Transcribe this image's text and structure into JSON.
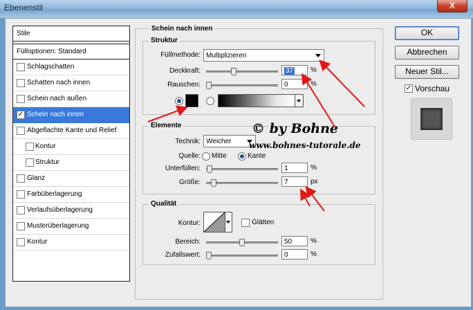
{
  "window": {
    "title": "Ebenenstil",
    "close_label": "X"
  },
  "style_list": {
    "header": "Stile",
    "blend_options": "Fülloptionen: Standard",
    "items": [
      {
        "label": "Schlagschatten",
        "checked": false
      },
      {
        "label": "Schatten nach innen",
        "checked": false
      },
      {
        "label": "Schein nach außen",
        "checked": false
      },
      {
        "label": "Schein nach innen",
        "checked": true
      },
      {
        "label": "Abgeflachte Kante und Relief",
        "checked": false
      },
      {
        "label": "Kontur",
        "checked": false
      },
      {
        "label": "Struktur",
        "checked": false
      },
      {
        "label": "Glanz",
        "checked": false
      },
      {
        "label": "Farbüberlagerung",
        "checked": false
      },
      {
        "label": "Verlaufsüberlagerung",
        "checked": false
      },
      {
        "label": "Musterüberlagerung",
        "checked": false
      },
      {
        "label": "Kontur",
        "checked": false
      }
    ],
    "check_mark": "✓"
  },
  "panel": {
    "title": "Schein nach innen",
    "struktur": {
      "title": "Struktur",
      "blend_mode_label": "Füllmethode:",
      "blend_mode_value": "Multiplizieren",
      "opacity_label": "Deckkraft:",
      "opacity_value": "37",
      "opacity_unit": "%",
      "opacity_level": 0.37,
      "noise_label": "Rauschen:",
      "noise_value": "0",
      "noise_unit": "%",
      "noise_level": 0,
      "swatch_color": "#000000"
    },
    "elemente": {
      "title": "Elemente",
      "technique_label": "Technik:",
      "technique_value": "Weicher",
      "source_label": "Quelle:",
      "source_center": "Mitte",
      "source_edge": "Kante",
      "source_selected": "Kante",
      "choke_label": "Unterfüllen:",
      "choke_value": "1",
      "choke_unit": "%",
      "choke_level": 0.01,
      "size_label": "Größe:",
      "size_value": "7",
      "size_unit": "px",
      "size_level": 0.07
    },
    "qualitaet": {
      "title": "Qualität",
      "contour_label": "Kontur:",
      "antialias_label": "Glätten",
      "antialias_checked": false,
      "range_label": "Bereich:",
      "range_value": "50",
      "range_unit": "%",
      "range_level": 0.5,
      "jitter_label": "Zufallswert:",
      "jitter_value": "0",
      "jitter_unit": "%",
      "jitter_level": 0
    }
  },
  "buttons": {
    "ok": "OK",
    "cancel": "Abbrechen",
    "new_style": "Neuer Stil...",
    "preview_label": "Vorschau",
    "preview_checked": true
  },
  "annotation": {
    "credit": "© by Bohne",
    "url": "www.bohnes-tutorale.de",
    "arrow_color": "#e01818"
  }
}
